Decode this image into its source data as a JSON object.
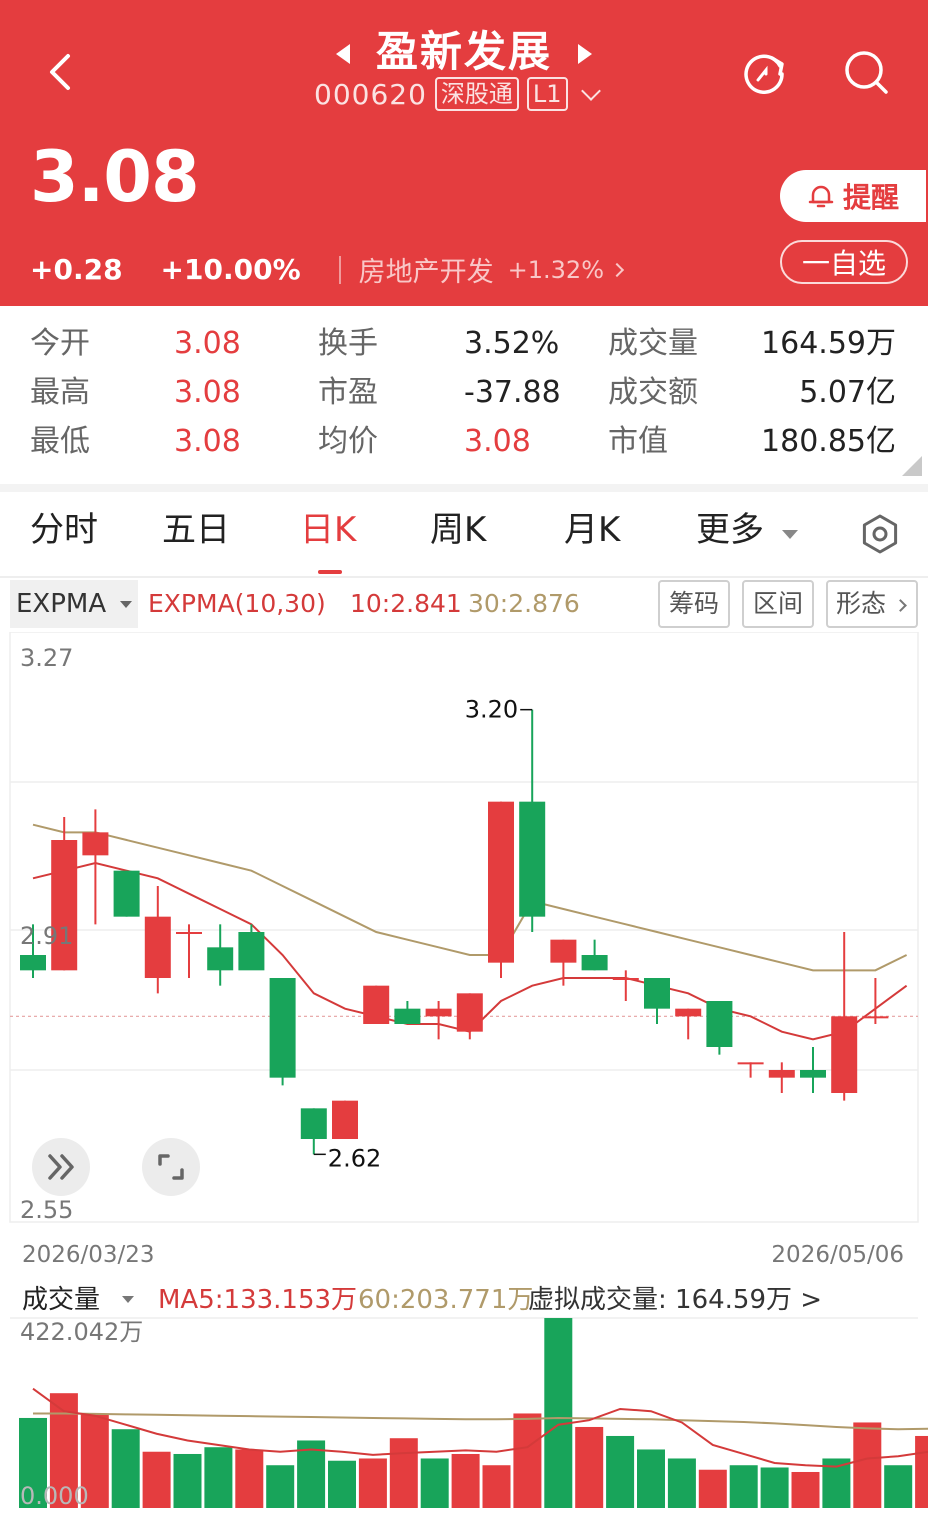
{
  "header": {
    "title": "盈新发展",
    "code": "000620",
    "tag_connect": "深股通",
    "tag_level": "L1",
    "price": "3.08",
    "change": "+0.28",
    "change_pct": "+10.00%",
    "sector": "房地产开发",
    "sector_change": "+1.32%",
    "remind_label": "提醒",
    "watch_label": "一自选"
  },
  "stats": [
    {
      "label": "今开",
      "value": "3.08",
      "red": true
    },
    {
      "label": "换手",
      "value": "3.52%",
      "red": false
    },
    {
      "label": "成交量",
      "value": "164.59万",
      "red": false
    },
    {
      "label": "最高",
      "value": "3.08",
      "red": true
    },
    {
      "label": "市盈",
      "value": "-37.88",
      "red": false
    },
    {
      "label": "成交额",
      "value": "5.07亿",
      "red": false
    },
    {
      "label": "最低",
      "value": "3.08",
      "red": true
    },
    {
      "label": "均价",
      "value": "3.08",
      "red": true
    },
    {
      "label": "市值",
      "value": "180.85亿",
      "red": false
    }
  ],
  "tabs": [
    "分时",
    "五日",
    "日K",
    "周K",
    "月K",
    "更多"
  ],
  "active_tab": "日K",
  "indicator": {
    "select": "EXPMA",
    "name": "EXPMA(10,30)",
    "ema10": "10:2.841",
    "ema30": "30:2.876",
    "chips": [
      "筹码",
      "区间",
      "形态"
    ]
  },
  "colors": {
    "up": "#e43d3f",
    "down": "#18a45a",
    "ema10": "#d43a3a",
    "ema30": "#b09a6a",
    "header": "#e43d3f"
  },
  "chart_data": [
    {
      "type": "candlestick",
      "y_top_label": "3.27",
      "y_mid_label": "2.91",
      "y_bottom_label": "2.55",
      "ylim": [
        2.55,
        3.27
      ],
      "x_start_label": "2026/03/23",
      "x_end_label": "2026/05/06",
      "annotation_high": "3.20",
      "annotation_low": "2.62",
      "candles": [
        {
          "o": 2.88,
          "h": 2.92,
          "l": 2.85,
          "c": 2.86
        },
        {
          "o": 2.86,
          "h": 3.06,
          "l": 2.86,
          "c": 3.03
        },
        {
          "o": 3.01,
          "h": 3.07,
          "l": 2.92,
          "c": 3.04
        },
        {
          "o": 2.99,
          "h": 2.99,
          "l": 2.93,
          "c": 2.93
        },
        {
          "o": 2.85,
          "h": 2.97,
          "l": 2.83,
          "c": 2.93
        },
        {
          "o": 2.91,
          "h": 2.92,
          "l": 2.85,
          "c": 2.91
        },
        {
          "o": 2.89,
          "h": 2.92,
          "l": 2.84,
          "c": 2.86
        },
        {
          "o": 2.91,
          "h": 2.92,
          "l": 2.87,
          "c": 2.86
        },
        {
          "o": 2.85,
          "h": 2.85,
          "l": 2.71,
          "c": 2.72
        },
        {
          "o": 2.68,
          "h": 2.68,
          "l": 2.62,
          "c": 2.64
        },
        {
          "o": 2.64,
          "h": 2.69,
          "l": 2.64,
          "c": 2.69
        },
        {
          "o": 2.79,
          "h": 2.84,
          "l": 2.79,
          "c": 2.84
        },
        {
          "o": 2.81,
          "h": 2.82,
          "l": 2.79,
          "c": 2.79
        },
        {
          "o": 2.8,
          "h": 2.82,
          "l": 2.77,
          "c": 2.81
        },
        {
          "o": 2.78,
          "h": 2.83,
          "l": 2.77,
          "c": 2.83
        },
        {
          "o": 2.87,
          "h": 3.08,
          "l": 2.85,
          "c": 3.08
        },
        {
          "o": 3.08,
          "h": 3.2,
          "l": 2.91,
          "c": 2.93
        },
        {
          "o": 2.87,
          "h": 2.9,
          "l": 2.84,
          "c": 2.9
        },
        {
          "o": 2.88,
          "h": 2.9,
          "l": 2.86,
          "c": 2.86
        },
        {
          "o": 2.85,
          "h": 2.86,
          "l": 2.82,
          "c": 2.85
        },
        {
          "o": 2.85,
          "h": 2.85,
          "l": 2.79,
          "c": 2.81
        },
        {
          "o": 2.8,
          "h": 2.81,
          "l": 2.77,
          "c": 2.81
        },
        {
          "o": 2.82,
          "h": 2.82,
          "l": 2.75,
          "c": 2.76
        },
        {
          "o": 2.74,
          "h": 2.74,
          "l": 2.72,
          "c": 2.74
        },
        {
          "o": 2.72,
          "h": 2.74,
          "l": 2.7,
          "c": 2.73
        },
        {
          "o": 2.73,
          "h": 2.76,
          "l": 2.7,
          "c": 2.72
        },
        {
          "o": 2.7,
          "h": 2.91,
          "l": 2.69,
          "c": 2.8
        },
        {
          "o": 2.8,
          "h": 2.85,
          "l": 2.79,
          "c": 2.8
        }
      ],
      "ema10": [
        2.98,
        2.99,
        3.0,
        2.99,
        2.98,
        2.96,
        2.94,
        2.92,
        2.88,
        2.83,
        2.81,
        2.8,
        2.79,
        2.79,
        2.78,
        2.82,
        2.84,
        2.85,
        2.85,
        2.85,
        2.84,
        2.83,
        2.81,
        2.8,
        2.78,
        2.77,
        2.78,
        2.81,
        2.84
      ],
      "ema30": [
        3.05,
        3.04,
        3.04,
        3.03,
        3.02,
        3.01,
        3.0,
        2.99,
        2.97,
        2.95,
        2.93,
        2.91,
        2.9,
        2.89,
        2.88,
        2.88,
        2.95,
        2.94,
        2.93,
        2.92,
        2.91,
        2.9,
        2.89,
        2.88,
        2.87,
        2.86,
        2.86,
        2.86,
        2.88
      ]
    },
    {
      "type": "bar",
      "title": "成交量",
      "ma5_label": "MA5:133.153万",
      "ma60_label": "60:203.771万",
      "virtual_label": "虚拟成交量: 164.59万 >",
      "y_top_label": "422.042万",
      "y_bottom_label": "0.000",
      "ylim": [
        0,
        422.042
      ],
      "values": [
        200,
        255,
        210,
        175,
        125,
        120,
        135,
        130,
        95,
        150,
        105,
        110,
        155,
        110,
        120,
        95,
        210,
        422,
        180,
        160,
        130,
        110,
        85,
        95,
        90,
        80,
        110,
        190,
        95,
        160
      ],
      "directions": [
        "down",
        "up",
        "up",
        "down",
        "up",
        "down",
        "down",
        "up",
        "down",
        "down",
        "down",
        "up",
        "up",
        "down",
        "up",
        "up",
        "up",
        "down",
        "up",
        "down",
        "down",
        "down",
        "up",
        "down",
        "down",
        "up",
        "down",
        "up",
        "down",
        "up"
      ],
      "ma5": [
        265,
        215,
        205,
        185,
        165,
        150,
        140,
        130,
        125,
        130,
        125,
        118,
        122,
        125,
        128,
        125,
        135,
        185,
        195,
        220,
        215,
        190,
        140,
        120,
        100,
        95,
        92,
        110,
        115,
        125
      ],
      "ma60": [
        210,
        210,
        209,
        208,
        207,
        206,
        205,
        204,
        203,
        202,
        201,
        200,
        199,
        198,
        197,
        197,
        198,
        200,
        199,
        198,
        197,
        195,
        193,
        191,
        188,
        184,
        180,
        177,
        175,
        176
      ]
    }
  ]
}
